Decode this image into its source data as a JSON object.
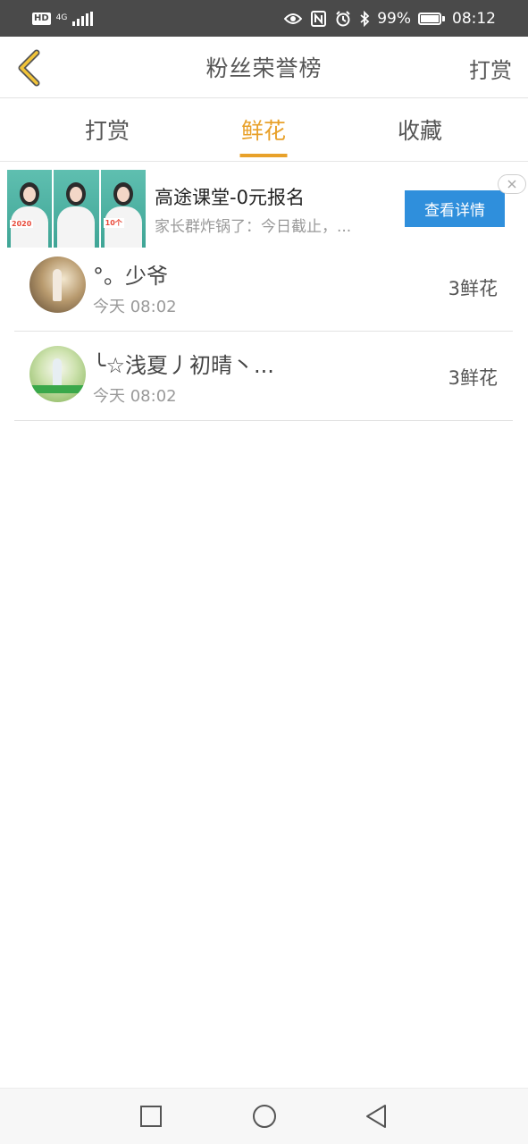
{
  "status_bar": {
    "left_badge": "HD",
    "network": "4G",
    "battery": "99%",
    "time": "08:12",
    "icons": [
      "hd-icon",
      "signal-icon",
      "eye-icon",
      "nfc-icon",
      "alarm-icon",
      "bluetooth-icon",
      "battery-icon"
    ]
  },
  "header": {
    "back_icon": "chevron-left-icon",
    "title": "粉丝荣誉榜",
    "right_label": "打赏"
  },
  "tabs": [
    {
      "label": "打赏",
      "active": false
    },
    {
      "label": "鲜花",
      "active": true
    },
    {
      "label": "收藏",
      "active": false
    }
  ],
  "ad": {
    "title": "高途课堂-0元报名",
    "description": "家长群炸锅了：今日截止，...",
    "cta": "查看详情",
    "close_icon": "close-icon",
    "thumb_tags": [
      "2020",
      "",
      "10个"
    ]
  },
  "list": [
    {
      "name": "°。少爷",
      "time": "今天 08:02",
      "amount": "3鲜花"
    },
    {
      "name": "╰☆浅夏丿初晴丶...",
      "time": "今天 08:02",
      "amount": "3鲜花"
    }
  ],
  "colors": {
    "accent": "#e8a12a",
    "status_bar_bg": "#4a4a4a",
    "cta_bg": "#2f8fdc"
  },
  "bottom_nav": [
    "square-icon",
    "circle-icon",
    "triangle-back-icon"
  ]
}
